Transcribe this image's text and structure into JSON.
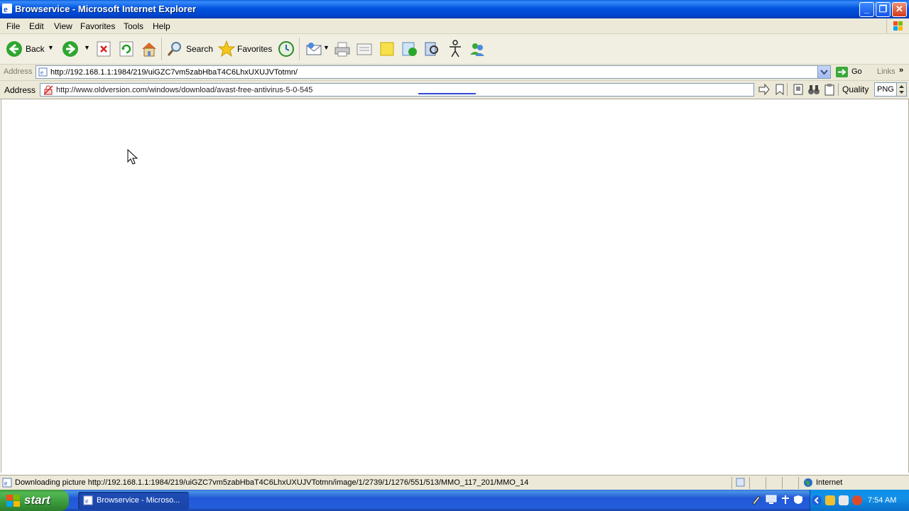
{
  "window": {
    "title": "Browservice - Microsoft Internet Explorer"
  },
  "menu": [
    "File",
    "Edit",
    "View",
    "Favorites",
    "Tools",
    "Help"
  ],
  "toolbar": {
    "back_label": "Back",
    "search_label": "Search",
    "favorites_label": "Favorites"
  },
  "address_bar": {
    "label": "Address",
    "url": "http://192.168.1.1:1984/219/uiGZC7vm5zabHbaT4C6LhxUXUJVTotmn/",
    "go_label": "Go",
    "links_label": "Links"
  },
  "browservice_bar": {
    "label": "Address",
    "url": "http://www.oldversion.com/windows/download/avast-free-antivirus-5-0-545",
    "quality_label": "Quality",
    "quality_value": "PNG"
  },
  "status_bar": {
    "text": "Downloading picture http://192.168.1.1:1984/219/uiGZC7vm5zabHbaT4C6LhxUXUJVTotmn/image/1/2739/1/1276/551/513/MMO_117_201/MMO_14",
    "zone": "Internet"
  },
  "taskbar": {
    "start_label": "start",
    "task_label": "Browservice - Microso...",
    "clock": "7:54 AM"
  }
}
